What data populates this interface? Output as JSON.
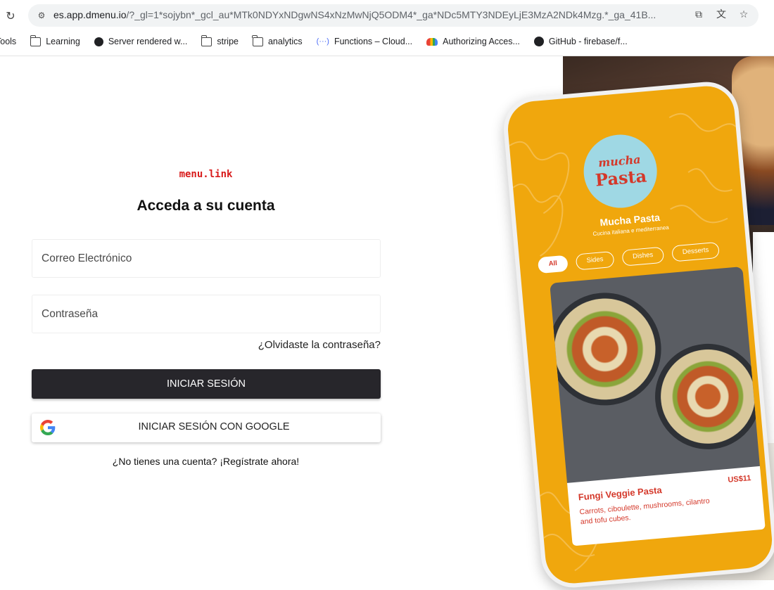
{
  "browser": {
    "url_host": "es.app.dmenu.io",
    "url_path": "/?_gl=1*sojybn*_gcl_au*MTk0NDYxNDgwNS4xNzMwNjQ5ODM4*_ga*NDc5MTY3NDEyLjE3MzA2NDk4Mzg.*_ga_41B...",
    "bookmarks": [
      {
        "label": "Tools",
        "icon": "folder-icon"
      },
      {
        "label": "Learning",
        "icon": "folder-icon"
      },
      {
        "label": "Server rendered w...",
        "icon": "globe-icon"
      },
      {
        "label": "stripe",
        "icon": "folder-icon"
      },
      {
        "label": "analytics",
        "icon": "folder-icon"
      },
      {
        "label": "Functions – Cloud...",
        "icon": "functions-icon"
      },
      {
        "label": "Authorizing Acces...",
        "icon": "google-cloud-icon"
      },
      {
        "label": "GitHub - firebase/f...",
        "icon": "github-icon"
      }
    ]
  },
  "login": {
    "logo": "menu.link",
    "title": "Acceda a su cuenta",
    "email_placeholder": "Correo Electrónico",
    "password_placeholder": "Contraseña",
    "forgot": "¿Olvidaste la contraseña?",
    "login_button": "INICIAR SESIÓN",
    "google_button": "INICIAR SESIÓN CON GOOGLE",
    "signup": "¿No tienes una cuenta? ¡Regístrate ahora!"
  },
  "promo": {
    "logo_line1": "mucha",
    "logo_line2": "Pasta",
    "restaurant_name": "Mucha Pasta",
    "restaurant_sub": "Cucina italiana e mediterranea",
    "chips": [
      "All",
      "Sides",
      "Dishes",
      "Desserts"
    ],
    "dish_name": "Fungi Veggie Pasta",
    "dish_price": "US$11",
    "dish_desc": "Carrots, ciboulette, mushrooms, cilantro and tofu cubes."
  },
  "colors": {
    "accent_red": "#d81b1b",
    "button_dark": "#27262b",
    "phone_yellow": "#f0a70d"
  }
}
